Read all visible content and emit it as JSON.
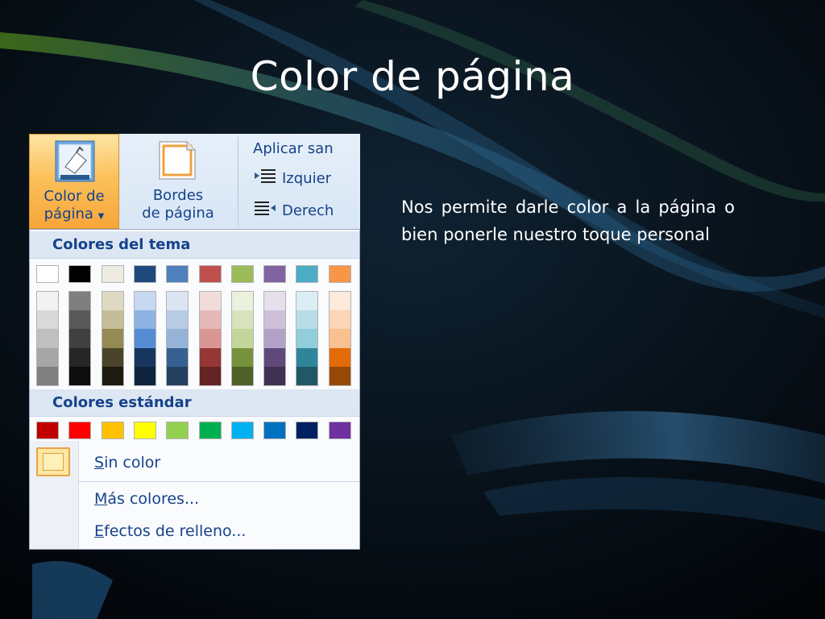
{
  "slide": {
    "title": "Color de página",
    "body": "Nos permite darle color  a la página o bien ponerle nuestro toque personal"
  },
  "ribbon": {
    "color_pagina": {
      "line1": "Color de",
      "line2": "página"
    },
    "bordes_pagina": {
      "line1": "Bordes",
      "line2": "de página"
    },
    "side_items": [
      "Aplicar san",
      "Izquier",
      "Derech"
    ]
  },
  "menu": {
    "theme_header": "Colores del tema",
    "standard_header": "Colores estándar",
    "theme_colors": [
      "#ffffff",
      "#000000",
      "#eeece1",
      "#1f497d",
      "#4f81bd",
      "#c0504d",
      "#9bbb59",
      "#8064a2",
      "#4bacc6",
      "#f79646"
    ],
    "theme_tints": [
      [
        "#f2f2f2",
        "#d9d9d9",
        "#bfbfbf",
        "#a6a6a6",
        "#808080"
      ],
      [
        "#7f7f7f",
        "#595959",
        "#404040",
        "#262626",
        "#0d0d0d"
      ],
      [
        "#ddd9c3",
        "#c4bd97",
        "#948a54",
        "#4a442a",
        "#1d1b10"
      ],
      [
        "#c6d9f0",
        "#8db3e2",
        "#548dd4",
        "#17365d",
        "#0f243e"
      ],
      [
        "#dbe5f1",
        "#b8cce4",
        "#95b3d7",
        "#366092",
        "#244061"
      ],
      [
        "#f2dcdb",
        "#e5b9b7",
        "#d99694",
        "#953734",
        "#632423"
      ],
      [
        "#ebf1dd",
        "#d7e3bc",
        "#c3d69b",
        "#76923c",
        "#4f6128"
      ],
      [
        "#e5e0ec",
        "#ccc1d9",
        "#b2a2c7",
        "#5f497a",
        "#3f3151"
      ],
      [
        "#dbeef3",
        "#b7dde8",
        "#92cddc",
        "#31859b",
        "#205867"
      ],
      [
        "#fdeada",
        "#fbd5b5",
        "#fac08f",
        "#e36c09",
        "#974806"
      ]
    ],
    "standard_colors": [
      "#c00000",
      "#ff0000",
      "#ffc000",
      "#ffff00",
      "#92d050",
      "#00b050",
      "#00b0f0",
      "#0070c0",
      "#002060",
      "#7030a0"
    ],
    "sin_color": {
      "accel": "S",
      "rest": "in color"
    },
    "mas_colores": {
      "accel": "M",
      "rest": "ás colores..."
    },
    "efectos": {
      "accel": "E",
      "rest": "fectos de relleno..."
    }
  }
}
